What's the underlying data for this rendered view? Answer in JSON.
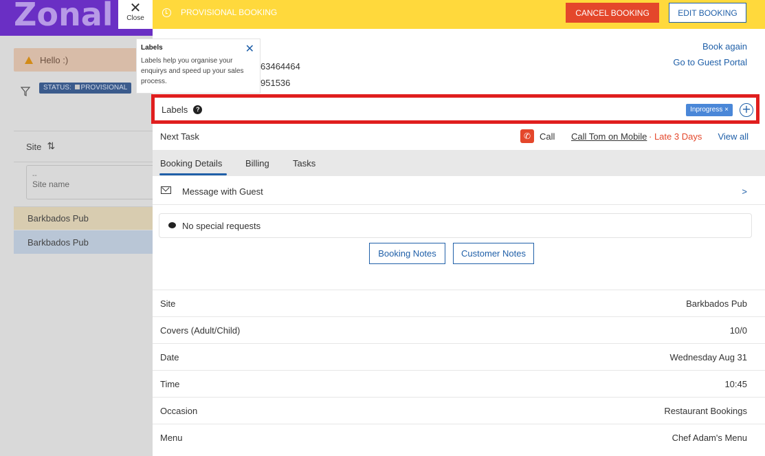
{
  "app": {
    "logo": "Zonal",
    "close_label": "Close"
  },
  "left": {
    "hello": "Hello :)",
    "status_badge": "STATUS:",
    "status_value": "PROVISIONAL",
    "site_header": "Site",
    "site_input_value": "--",
    "site_input_placeholder": "Site name",
    "rows": [
      "Barkbados Pub",
      "Barkbados Pub"
    ]
  },
  "tooltip": {
    "title": "Labels",
    "body": "Labels help you organise your enquirys and speed up your sales process."
  },
  "header": {
    "status": "PROVISIONAL BOOKING",
    "cancel_label": "CANCEL BOOKING",
    "edit_label": "EDIT BOOKING"
  },
  "contact": {
    "phone1": "63464464",
    "phone2": "951536"
  },
  "links": {
    "book_again": "Book again",
    "guest_portal": "Go to Guest Portal"
  },
  "labels": {
    "label": "Labels",
    "tag": "Inprogress",
    "tag_remove": "×"
  },
  "next_task": {
    "label": "Next Task",
    "call_label": "Call",
    "task": "Call Tom on Mobile",
    "due": "· Late 3 Days",
    "view_all": "View all"
  },
  "tabs": [
    "Booking Details",
    "Billing",
    "Tasks"
  ],
  "message": {
    "label": "Message with Guest",
    "arrow": ">"
  },
  "special_requests": "No special requests",
  "notes": {
    "booking": "Booking Notes",
    "customer": "Customer Notes"
  },
  "details": [
    {
      "key": "Site",
      "value": "Barkbados Pub"
    },
    {
      "key": "Covers (Adult/Child)",
      "value": "10/0"
    },
    {
      "key": "Date",
      "value": "Wednesday Aug 31"
    },
    {
      "key": "Time",
      "value": "10:45"
    },
    {
      "key": "Occasion",
      "value": "Restaurant Bookings"
    },
    {
      "key": "Menu",
      "value": "Chef Adam's Menu"
    }
  ],
  "colors": {
    "accent": "#1f5fa8",
    "warning_bar": "#ffd93c",
    "danger": "#e4472b",
    "brand": "#6a2fc4",
    "highlight": "#e01e1e"
  }
}
